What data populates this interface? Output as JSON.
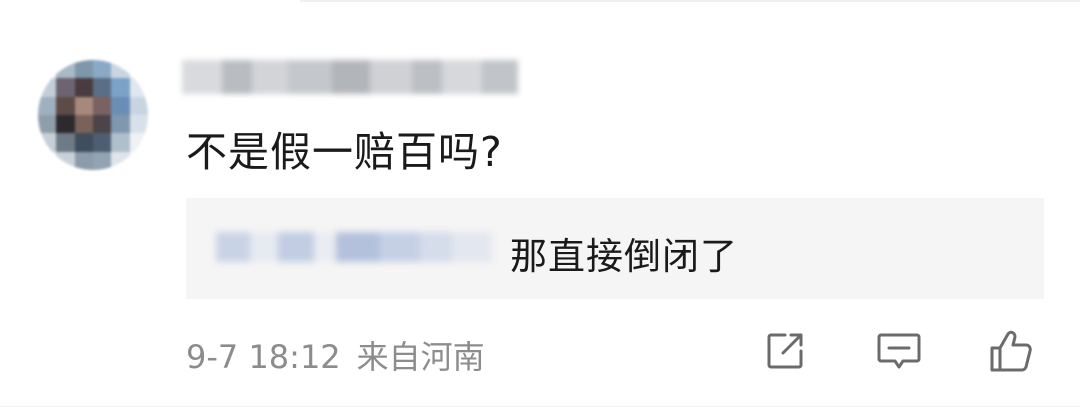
{
  "comment": {
    "text": "不是假一赔百吗?",
    "reply": {
      "text": "那直接倒闭了"
    },
    "meta": {
      "time": "9-7 18:12",
      "location": "来自河南"
    }
  },
  "actions": {
    "share_icon": "share-icon",
    "reply_icon": "comment-icon",
    "like_icon": "thumbs-up-icon"
  },
  "colors": {
    "text": "#1a1a1a",
    "meta": "#8c8c8c",
    "reply_bg": "#f5f5f5",
    "icon": "#6b6b6b"
  }
}
